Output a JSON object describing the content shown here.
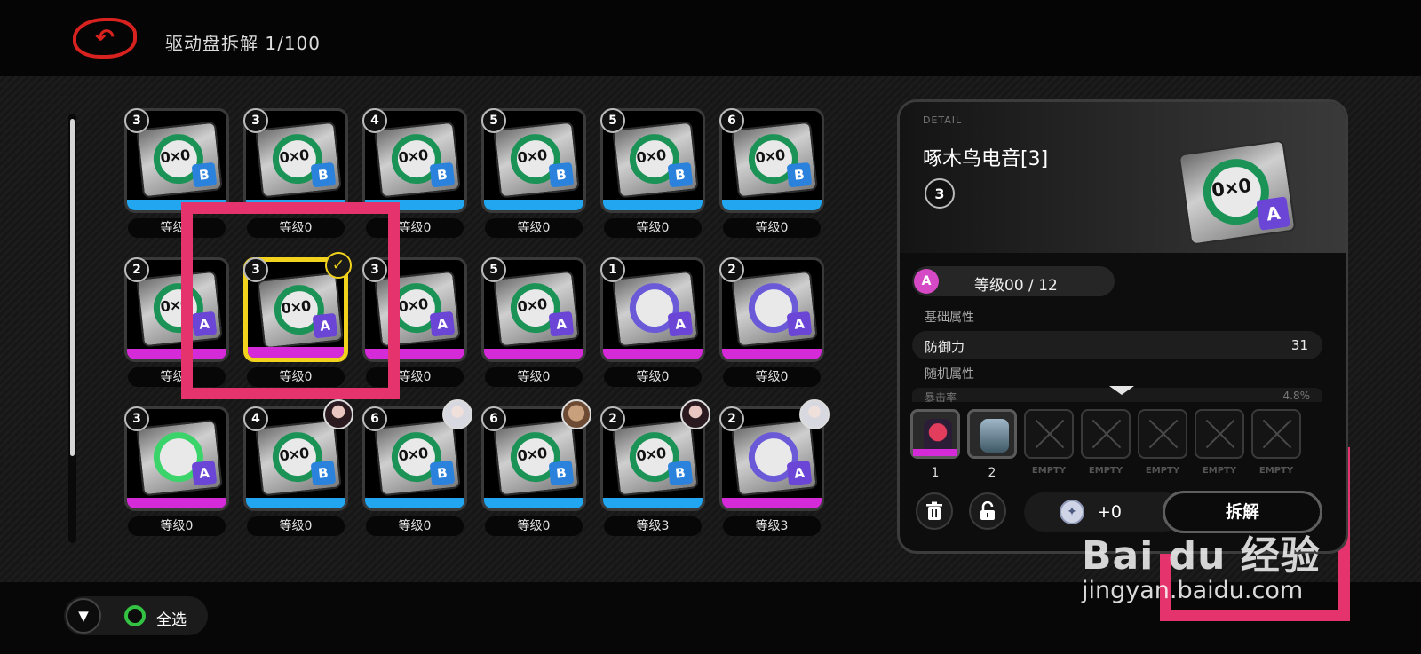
{
  "header": {
    "back_icon": "return-arrow",
    "title": "驱动盘拆解 1/100"
  },
  "colors": {
    "accent_red": "#d8221f",
    "selection_yellow": "#f1d21c",
    "highlight_pink": "#e5336e",
    "rarity_b_blue": "#21a6ef",
    "rarity_a_magenta": "#d52ad8"
  },
  "grid": {
    "rows": [
      [
        {
          "rank": "3",
          "rarity": "B",
          "level": "等级0",
          "ring": "green"
        },
        {
          "rank": "3",
          "rarity": "B",
          "level": "等级0",
          "ring": "green"
        },
        {
          "rank": "4",
          "rarity": "B",
          "level": "等级0",
          "ring": "green"
        },
        {
          "rank": "5",
          "rarity": "B",
          "level": "等级0",
          "ring": "green"
        },
        {
          "rank": "5",
          "rarity": "B",
          "level": "等级0",
          "ring": "green"
        },
        {
          "rank": "6",
          "rarity": "B",
          "level": "等级0",
          "ring": "green"
        }
      ],
      [
        {
          "rank": "2",
          "rarity": "A",
          "level": "等级0",
          "ring": "green"
        },
        {
          "rank": "3",
          "rarity": "A",
          "level": "等级0",
          "ring": "green",
          "selected": true
        },
        {
          "rank": "3",
          "rarity": "A",
          "level": "等级0",
          "ring": "green"
        },
        {
          "rank": "5",
          "rarity": "A",
          "level": "等级0",
          "ring": "green"
        },
        {
          "rank": "1",
          "rarity": "A",
          "level": "等级0",
          "ring": "purple"
        },
        {
          "rank": "2",
          "rarity": "A",
          "level": "等级0",
          "ring": "purple"
        }
      ],
      [
        {
          "rank": "3",
          "rarity": "A",
          "level": "等级0",
          "ring": "lime"
        },
        {
          "rank": "4",
          "rarity": "B",
          "level": "等级0",
          "ring": "green",
          "equipped": "avatar-dark-hair"
        },
        {
          "rank": "6",
          "rarity": "B",
          "level": "等级0",
          "ring": "green",
          "equipped": "avatar-white-hair"
        },
        {
          "rank": "6",
          "rarity": "B",
          "level": "等级0",
          "ring": "green",
          "equipped": "avatar-bear"
        },
        {
          "rank": "2",
          "rarity": "B",
          "level": "等级3",
          "ring": "green",
          "equipped": "avatar-dark-hair"
        },
        {
          "rank": "2",
          "rarity": "A",
          "level": "等级3",
          "ring": "purple",
          "equipped": "avatar-white-hair"
        }
      ]
    ]
  },
  "detail": {
    "tag": "DETAIL",
    "name": "啄木鸟电音[3]",
    "rank": "3",
    "rarity": "A",
    "level_text": "等级00 / 12",
    "base_title": "基础属性",
    "stat_name": "防御力",
    "stat_value": "31",
    "random_title": "随机属性",
    "faded_row_text": "暴击率",
    "faded_row_value": "4.8%",
    "slots": [
      {
        "label": "1",
        "filled": true,
        "icon": "agent-red-helmet"
      },
      {
        "label": "2",
        "filled": true,
        "icon": "agent-canister"
      },
      {
        "label": "EMPTY",
        "filled": false
      },
      {
        "label": "EMPTY",
        "filled": false
      },
      {
        "label": "EMPTY",
        "filled": false
      },
      {
        "label": "EMPTY",
        "filled": false
      },
      {
        "label": "EMPTY",
        "filled": false
      }
    ],
    "trash_icon": "trash-icon",
    "lock_icon": "unlock-icon",
    "reward_icon": "dennies-coin",
    "reward_text": "+0",
    "dismantle_label": "拆解"
  },
  "footer": {
    "filter_icon": "filter-icon",
    "select_all_label": "全选"
  },
  "watermark": {
    "logo": "Bai du 经验",
    "url": "jingyan.baidu.com"
  }
}
